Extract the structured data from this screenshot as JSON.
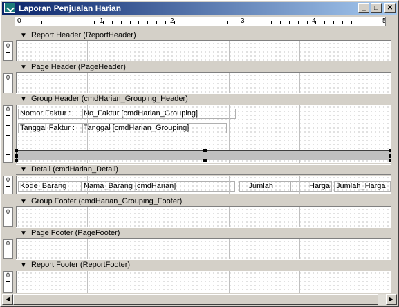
{
  "window": {
    "title": "Laporan Penjualan Harian",
    "controls": {
      "minimize": "_",
      "maximize": "□",
      "close": "✕"
    }
  },
  "ruler": {
    "marks": [
      "0",
      "1",
      "2",
      "3",
      "4",
      "5"
    ]
  },
  "sections": [
    {
      "label": "Report Header (ReportHeader)"
    },
    {
      "label": "Page Header (PageHeader)"
    },
    {
      "label": "Group Header (cmdHarian_Grouping_Header)"
    },
    {
      "label": "Detail (cmdHarian_Detail)"
    },
    {
      "label": "Group Footer (cmdHarian_Grouping_Footer)"
    },
    {
      "label": "Page Footer (PageFooter)"
    },
    {
      "label": "Report Footer (ReportFooter)"
    }
  ],
  "vertical_ruler_label": "0",
  "group_header_fields": {
    "nomor_label": "Nomor Faktur :",
    "nomor_value": "No_Faktur [cmdHarian_Grouping]",
    "tanggal_label": "Tanggal Faktur :",
    "tanggal_value": "Tanggal [cmdHarian_Grouping]"
  },
  "detail_fields": {
    "kode": "Kode_Barang",
    "nama": "Nama_Barang [cmdHarian]",
    "jumlah": "Jumlah",
    "harga": "Harga",
    "jumlah_harga": "Jumlah_Harga"
  },
  "icons": {
    "section_arrow": "section-arrow-icon",
    "app": "report-app-icon"
  }
}
